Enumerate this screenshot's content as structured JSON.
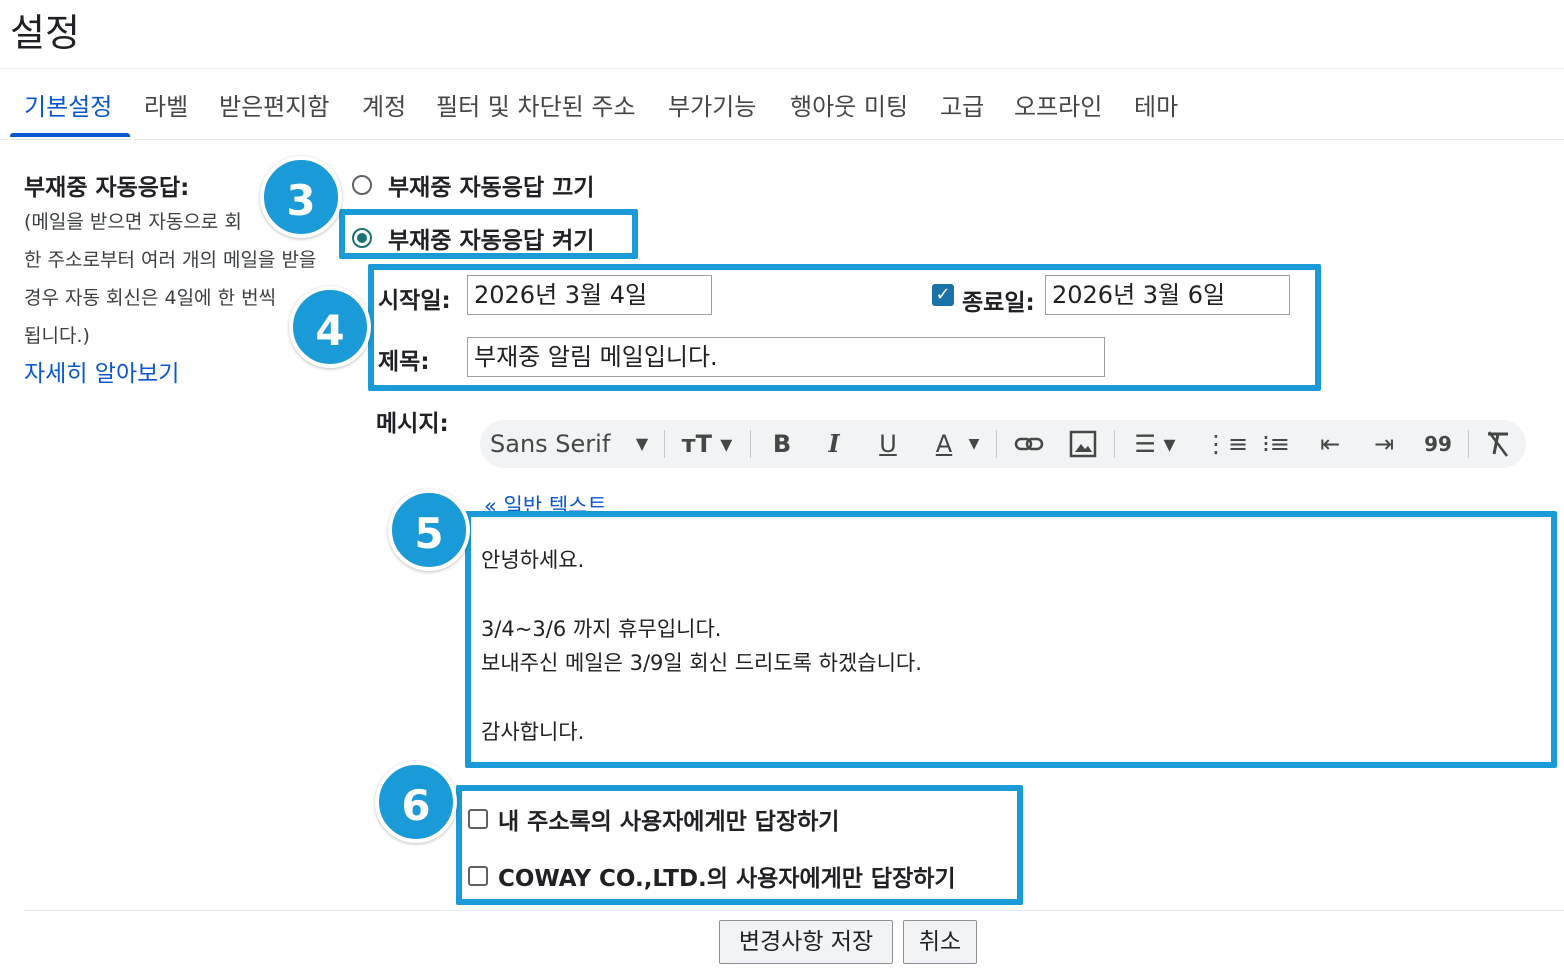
{
  "page": {
    "title": "설정"
  },
  "tabs": [
    {
      "label": "기본설정"
    },
    {
      "label": "라벨"
    },
    {
      "label": "받은편지함"
    },
    {
      "label": "계정"
    },
    {
      "label": "필터 및 차단된 주소"
    },
    {
      "label": "부가기능"
    },
    {
      "label": "행아웃 미팅"
    },
    {
      "label": "고급"
    },
    {
      "label": "오프라인"
    },
    {
      "label": "테마"
    }
  ],
  "vacation": {
    "label": "부재중 자동응답:",
    "description": [
      "(메일을 받으면 자동으로 회",
      "한 주소로부터 여러 개의 메일을 받을",
      "경우 자동 회신은 4일에 한 번씩",
      "됩니다.)"
    ],
    "learn_more": "자세히 알아보기",
    "off_label": "부재중 자동응답 끄기",
    "on_label": "부재중 자동응답 켜기",
    "start_label": "시작일:",
    "start_value": "2026년 3월 4일",
    "end_label": "종료일:",
    "end_value": "2026년 3월 6일",
    "subject_label": "제목:",
    "subject_value": "부재중 알림 메일입니다.",
    "message_label": "메시지:",
    "plain_text_link": "« 일반 텍스트",
    "message_lines": [
      "안녕하세요.",
      "3/4~3/6 까지 휴무입니다.",
      "보내주신 메일은 3/9일 회신 드리도록 하겠습니다.",
      "감사합니다."
    ],
    "contacts_only": "내 주소록의 사용자에게만 답장하기",
    "org_only": "COWAY CO.,LTD.의 사용자에게만 답장하기"
  },
  "toolbar": {
    "font": "Sans Serif",
    "bold": "B",
    "italic": "I",
    "underline": "U",
    "text_color": "A",
    "quote": "99"
  },
  "buttons": {
    "save": "변경사항 저장",
    "cancel": "취소"
  },
  "badges": [
    "3",
    "4",
    "5",
    "6"
  ],
  "colors": {
    "accent": "#0b57d0",
    "highlight": "#1a9ad6",
    "radio": "#1a7373"
  }
}
